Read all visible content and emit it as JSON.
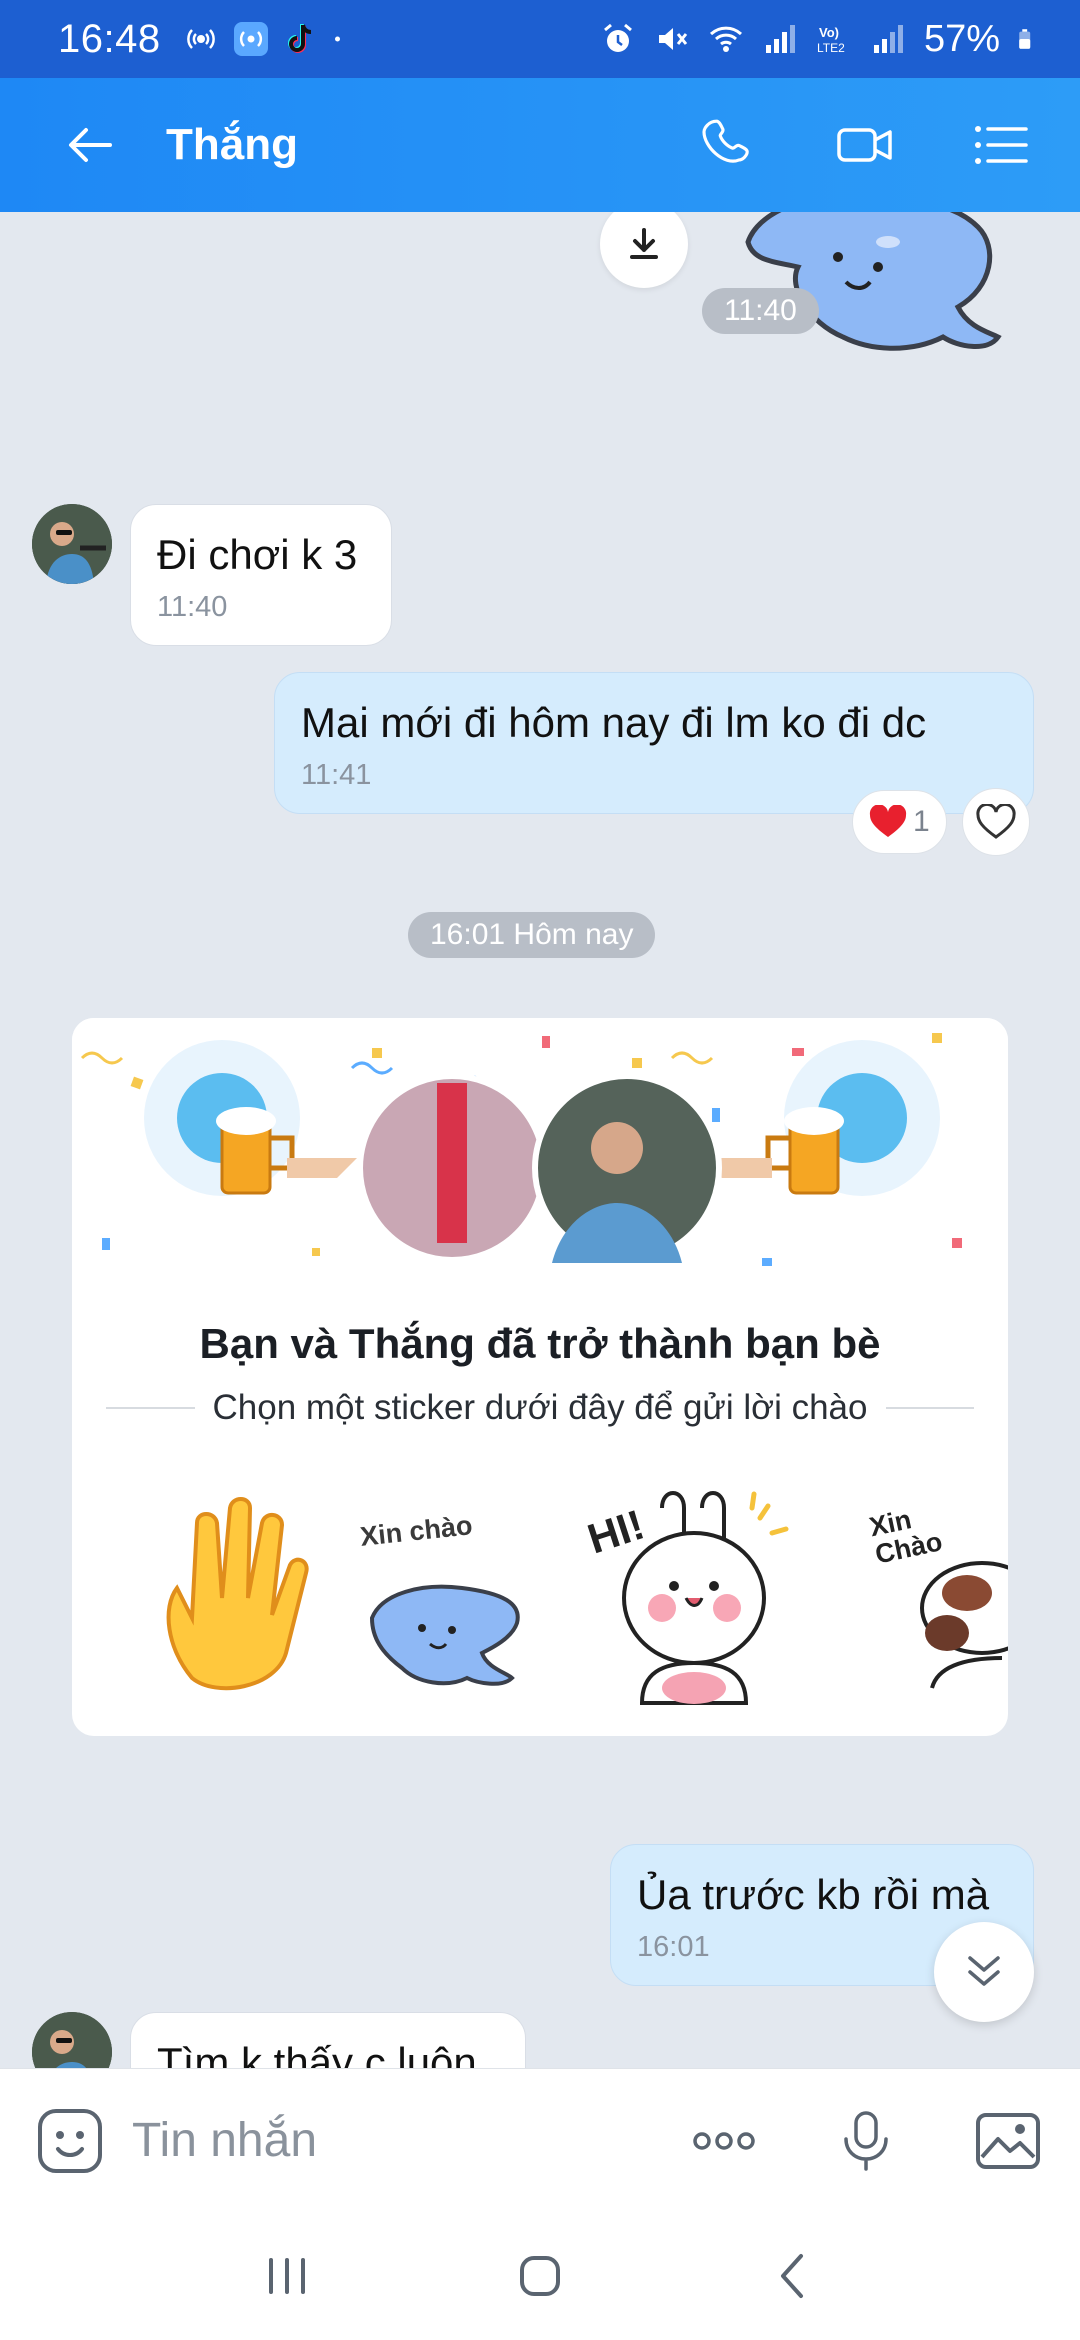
{
  "status_bar": {
    "time": "16:48",
    "battery": "57%",
    "left_icons": [
      "hotspot-icon",
      "hotspot-badge-icon",
      "tiktok-icon",
      "dot-icon"
    ],
    "right_icons": [
      "alarm-icon",
      "mute-icon",
      "wifi-icon",
      "signal-icon",
      "volte-icon",
      "signal2-icon",
      "battery-icon"
    ]
  },
  "header": {
    "title": "Thắng",
    "actions": [
      "phone-icon",
      "video-call-icon",
      "menu-list-icon"
    ]
  },
  "chat": {
    "time_chip_1": "11:40",
    "msg1": {
      "text": "Đi chơi k 3",
      "time": "11:40"
    },
    "msg2": {
      "text": "Mai mới đi  hôm nay  đi lm  ko đi dc",
      "time": "11:41",
      "reaction_count": "1"
    },
    "time_chip_2": "16:01 Hôm nay",
    "friend_card": {
      "title": "Bạn và Thắng đã trở thành bạn bè",
      "subtitle": "Chọn một sticker dưới đây để gửi lời chào",
      "sticker_texts": [
        "Xin chào",
        "HI!",
        "Xin Chào"
      ]
    },
    "msg3": {
      "text": "Ủa trước kb rồi mà",
      "time": "16:01"
    },
    "msg4_partial": "Tìm k thấy c luôn"
  },
  "input": {
    "placeholder": "Tin nhắn"
  },
  "colors": {
    "header": "#1e88f5",
    "status_bar": "#1d5fd1",
    "outgoing_bubble": "#d5ecfd",
    "chat_bg": "#e3e8ef"
  }
}
